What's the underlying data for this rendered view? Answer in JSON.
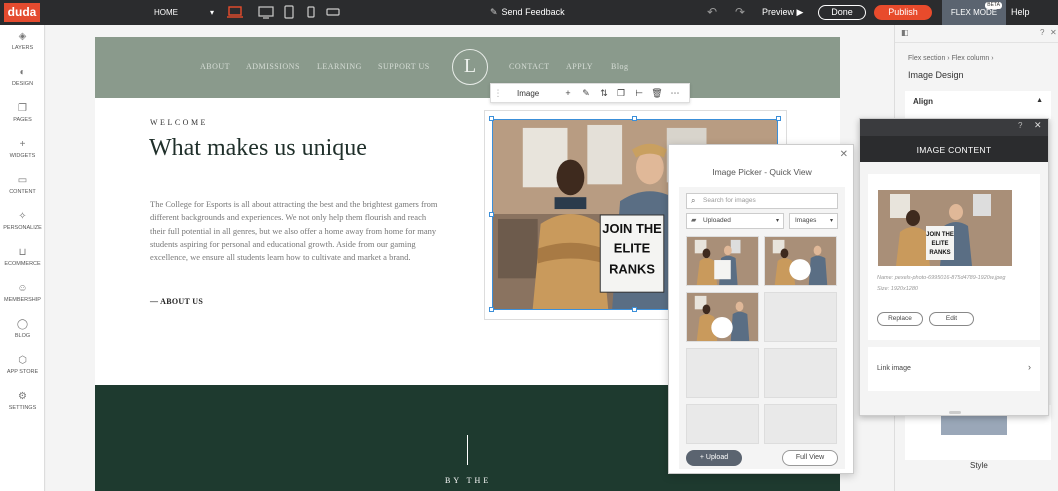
{
  "topbar": {
    "logo": "duda",
    "page_select": "HOME",
    "send_feedback": "Send Feedback",
    "preview": "Preview",
    "done": "Done",
    "publish": "Publish",
    "flex_mode": "FLEX MODE",
    "beta": "BETA",
    "help": "Help"
  },
  "sidebar": {
    "items": [
      {
        "label": "LAYERS",
        "icon": "layers-icon"
      },
      {
        "label": "DESIGN",
        "icon": "palette-icon"
      },
      {
        "label": "PAGES",
        "icon": "pages-icon"
      },
      {
        "label": "WIDGETS",
        "icon": "plus-icon"
      },
      {
        "label": "CONTENT",
        "icon": "folder-icon"
      },
      {
        "label": "PERSONALIZE",
        "icon": "personalize-icon"
      },
      {
        "label": "ECOMMERCE",
        "icon": "cart-icon"
      },
      {
        "label": "MEMBERSHIP",
        "icon": "user-icon"
      },
      {
        "label": "BLOG",
        "icon": "chat-icon"
      },
      {
        "label": "APP STORE",
        "icon": "appstore-icon"
      },
      {
        "label": "SETTINGS",
        "icon": "gear-icon"
      }
    ]
  },
  "site": {
    "nav": [
      "ABOUT",
      "ADMISSIONS",
      "LEARNING",
      "SUPPORT US",
      "CONTACT",
      "APPLY",
      "Blog"
    ],
    "logo_letter": "L",
    "welcome": "WELCOME",
    "headline": "What makes us unique",
    "body": "The College for Esports is all about attracting the best and the brightest gamers from different backgrounds and experiences. We not only help them flourish and reach their full potential in all genres, but we also offer a home away from home for many students aspiring for personal and educational growth. Aside from our gaming excellence, we ensure all students learn how to cultivate and market a brand.",
    "about_link": "— ABOUT US",
    "by_the": "BY THE",
    "sign_lines": [
      "JOIN THE",
      "ELITE",
      "RANKS"
    ]
  },
  "image_toolbar": {
    "label": "Image"
  },
  "picker": {
    "title": "Image Picker - Quick View",
    "search_placeholder": "Search for images",
    "source": "Uploaded",
    "type": "Images",
    "upload": "Upload",
    "full_view": "Full View"
  },
  "right_panel": {
    "breadcrumb": "Flex section  ›  Flex column  ›",
    "title": "Image Design",
    "align": "Align",
    "style": "Style"
  },
  "content_panel": {
    "title": "IMAGE CONTENT",
    "name": "Name: pexels-photo-6995016-875d4789-1920w.jpeg",
    "size": "Size: 1920x1280",
    "replace": "Replace",
    "edit": "Edit",
    "link_image": "Link image"
  },
  "colors": {
    "brand": "#e44b2f",
    "publish": "#e84b2c",
    "nav_bg": "#8a9a8c",
    "dark_section": "#1e3a2f",
    "selection": "#3b8fd9"
  }
}
